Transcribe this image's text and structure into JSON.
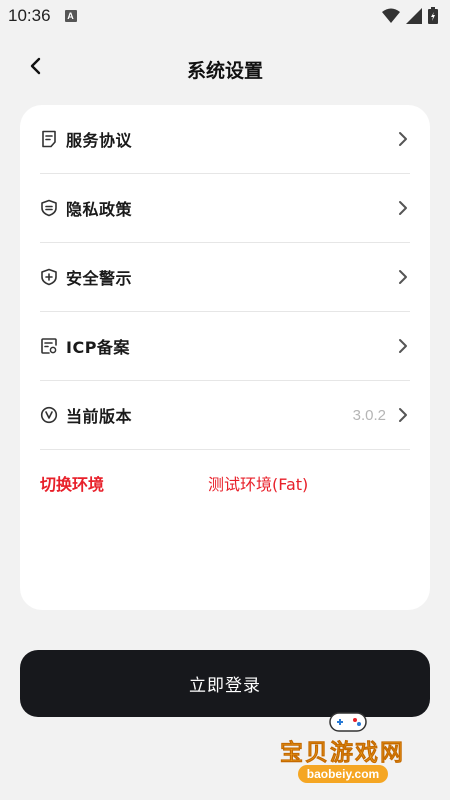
{
  "status_bar": {
    "time": "10:36",
    "notification_glyph": "A"
  },
  "header": {
    "title": "系统设置",
    "back_icon": "chevron-left-icon"
  },
  "settings": {
    "items": [
      {
        "label": "服务协议",
        "icon": "document-icon"
      },
      {
        "label": "隐私政策",
        "icon": "shield-list-icon"
      },
      {
        "label": "安全警示",
        "icon": "shield-plus-icon"
      },
      {
        "label": "ICP备案",
        "icon": "certificate-icon"
      },
      {
        "label": "当前版本",
        "icon": "version-v-icon",
        "value": "3.0.2"
      }
    ],
    "environment": {
      "label": "切换环境",
      "value": "测试环境(Fat)"
    }
  },
  "login_button": {
    "label": "立即登录"
  },
  "watermark": {
    "title": "宝贝游戏网",
    "url": "baobeiy.com"
  },
  "colors": {
    "accent_red": "#e8202a",
    "button_dark": "#17181c",
    "watermark_orange": "#f5a623"
  }
}
